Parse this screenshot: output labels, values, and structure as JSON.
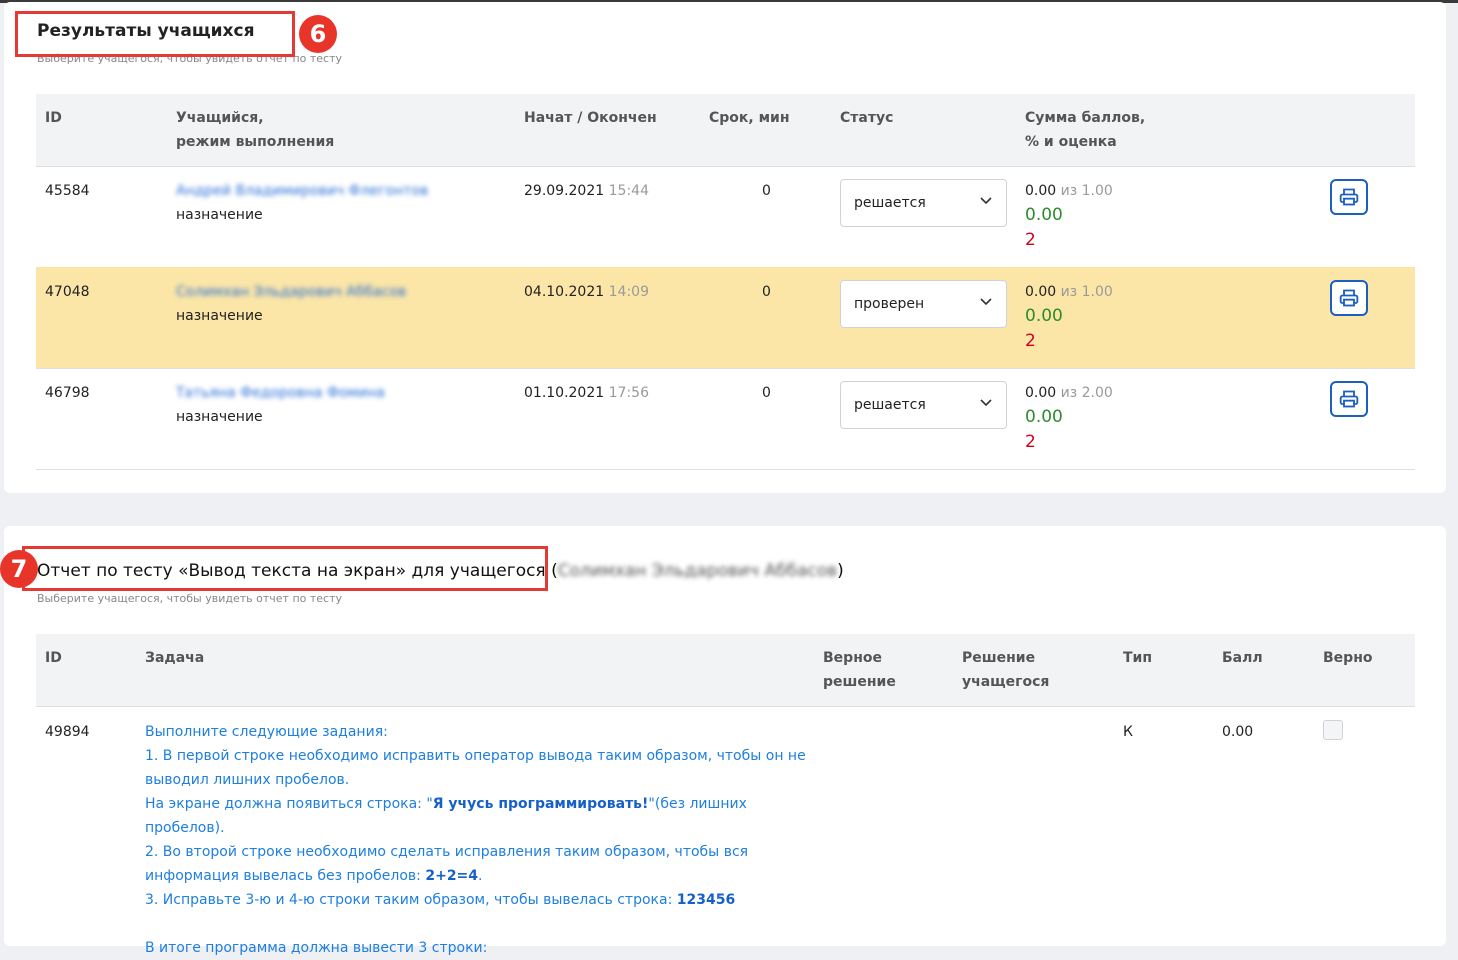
{
  "results": {
    "title": "Результаты учащихся",
    "subtitle": "Выберите учащегося, чтобы увидеть отчет по тесту",
    "marker": "6",
    "columns": {
      "id": "ID",
      "student_line1": "Учащийся,",
      "student_line2": "режим выполнения",
      "started": "Начат / Окончен",
      "duration": "Срок, мин",
      "status": "Статус",
      "score_line1": "Сумма баллов,",
      "score_line2": "% и оценка"
    },
    "rows": [
      {
        "id": "45584",
        "name": "Андрей Владимирович Флегонтов",
        "mode": "назначение",
        "date": "29.09.2021",
        "time": "15:44",
        "duration": "0",
        "status": "решается",
        "score": "0.00",
        "of": "из 1.00",
        "percent": "0.00",
        "grade": "2"
      },
      {
        "id": "47048",
        "name": "Солимхан Эльдарович Аббасов",
        "mode": "назначение",
        "date": "04.10.2021",
        "time": "14:09",
        "duration": "0",
        "status": "проверен",
        "score": "0.00",
        "of": "из 1.00",
        "percent": "0.00",
        "grade": "2"
      },
      {
        "id": "46798",
        "name": "Татьяна Федоровна Фомина",
        "mode": "назначение",
        "date": "01.10.2021",
        "time": "17:56",
        "duration": "0",
        "status": "решается",
        "score": "0.00",
        "of": "из 2.00",
        "percent": "0.00",
        "grade": "2"
      }
    ]
  },
  "report": {
    "title": "Отчет по тесту «Вывод текста на экран» для учащегося",
    "student_open": "(",
    "student": "Солимхан Эльдарович Аббасов",
    "student_close": ")",
    "subtitle": "Выберите учащегося, чтобы увидеть отчет по тесту",
    "marker": "7",
    "columns": {
      "id": "ID",
      "task": "Задача",
      "correct_line1": "Верное",
      "correct_line2": "решение",
      "answer_line1": "Решение",
      "answer_line2": "учащегося",
      "type": "Тип",
      "score": "Балл",
      "right": "Верно"
    },
    "row": {
      "id": "49894",
      "type": "К",
      "score": "0.00",
      "task": {
        "l1": "Выполните следующие задания:",
        "l2": "1. В первой строке необходимо исправить оператор вывода таким образом, чтобы он не",
        "l3": "выводил лишних пробелов.",
        "l4a": "На экране должна появиться строка: \"",
        "l4b": "Я учусь программировать!",
        "l4c": "\"(без лишних пробелов).",
        "l5": "2. Во второй строке необходимо сделать исправления таким образом, чтобы вся",
        "l6a": "информация вывелась без пробелов: ",
        "l6b": "2+2=4",
        "l6c": ".",
        "l7a": "3. Исправьте 3-ю и 4-ю строки таким образом, чтобы вывелась строка: ",
        "l7b": "123456",
        "l8": "В итоге программа должна вывести 3 строки:"
      }
    }
  },
  "colors": {
    "accent": "#1c5fbf",
    "highlight_row": "#fbe6a8",
    "annotation": "#e53935",
    "grade": "#d0021b",
    "percent": "#2e8b2e"
  }
}
